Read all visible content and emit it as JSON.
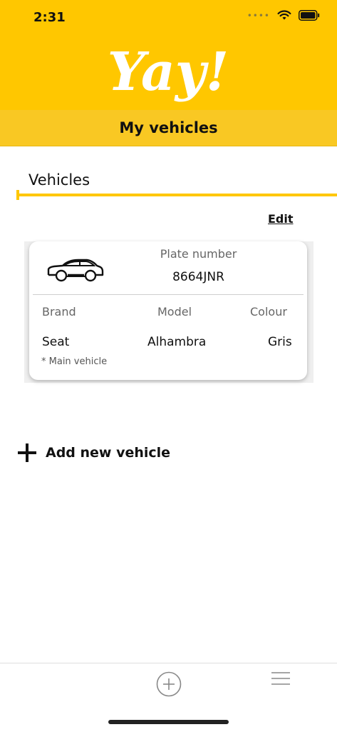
{
  "status_bar": {
    "time": "2:31",
    "signal_icon": "signal-dots-icon",
    "wifi_icon": "wifi-icon",
    "battery_icon": "battery-icon"
  },
  "header": {
    "logo_text": "Yay!",
    "title": "My vehicles",
    "brand_color": "#FFC700"
  },
  "vehicles_section": {
    "title": "Vehicles",
    "edit_label": "Edit"
  },
  "vehicle_card": {
    "icon": "car-icon",
    "plate_label": "Plate number",
    "plate_value": "8664JNR",
    "columns": [
      {
        "label": "Brand",
        "value": "Seat"
      },
      {
        "label": "Model",
        "value": "Alhambra"
      },
      {
        "label": "Colour",
        "value": "Gris"
      }
    ],
    "note": "* Main vehicle"
  },
  "add_vehicle": {
    "icon": "plus-icon",
    "label": "Add new vehicle"
  },
  "bottom_nav": {
    "items": [
      {
        "icon": "plus-circle-icon"
      },
      {
        "icon": "menu-icon"
      }
    ]
  }
}
